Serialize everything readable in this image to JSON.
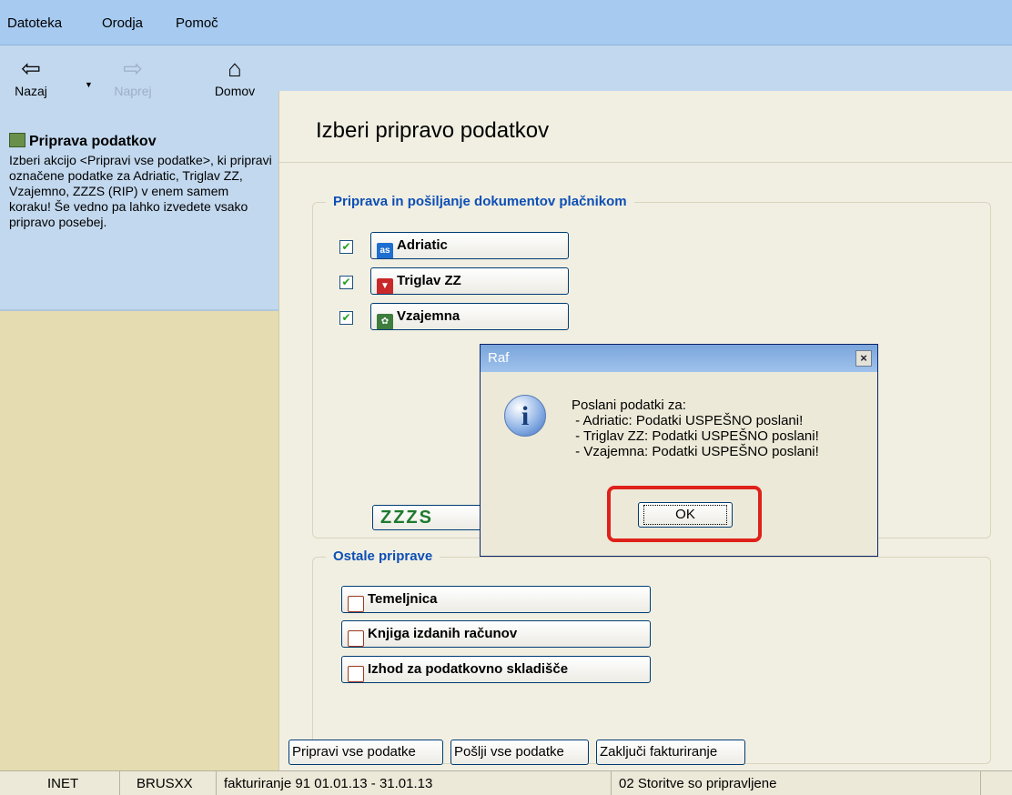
{
  "menu": {
    "items": [
      "Datoteka",
      "Orodja",
      "Pomoč"
    ]
  },
  "toolbar": {
    "back": "Nazaj",
    "forward": "Naprej",
    "home": "Domov"
  },
  "sidebar": {
    "title": "Priprava podatkov",
    "description": "Izberi akcijo <Pripravi vse podatke>, ki pripravi označene podatke za Adriatic, Triglav ZZ, Vzajemno, ZZZS (RIP) v enem samem koraku! Še vedno pa lahko izvedete vsako pripravo posebej."
  },
  "main": {
    "title": "Izberi pripravo podatkov",
    "group1": {
      "title": "Priprava in pošiljanje dokumentov plačnikom",
      "items": [
        {
          "label": "Adriatic",
          "icon": "as-logo-icon",
          "checked": true
        },
        {
          "label": "Triglav ZZ",
          "icon": "triglav-logo-icon",
          "checked": true
        },
        {
          "label": "Vzajemna",
          "icon": "vzajemna-logo-icon",
          "checked": true
        }
      ],
      "zzzs_label": "ZZZS"
    },
    "group2": {
      "title": "Ostale priprave",
      "items": [
        "Temeljnica",
        "Knjiga izdanih računov",
        "Izhod za podatkovno skladišče"
      ]
    },
    "bottom_buttons": [
      "Pripravi vse podatke",
      "Pošlji vse podatke",
      "Zaključi fakturiranje"
    ]
  },
  "status": {
    "cells": [
      "INET",
      "BRUSXX",
      "fakturiranje 91  01.01.13 - 31.01.13",
      "02 Storitve so pripravljene"
    ]
  },
  "dialog": {
    "title": "Raf",
    "close": "×",
    "message": "Poslani podatki za:\n - Adriatic: Podatki USPEŠNO poslani!\n - Triglav ZZ: Podatki USPEŠNO poslani!\n - Vzajemna: Podatki USPEŠNO poslani!",
    "ok": "OK",
    "highlight_color": "#e0201a"
  }
}
